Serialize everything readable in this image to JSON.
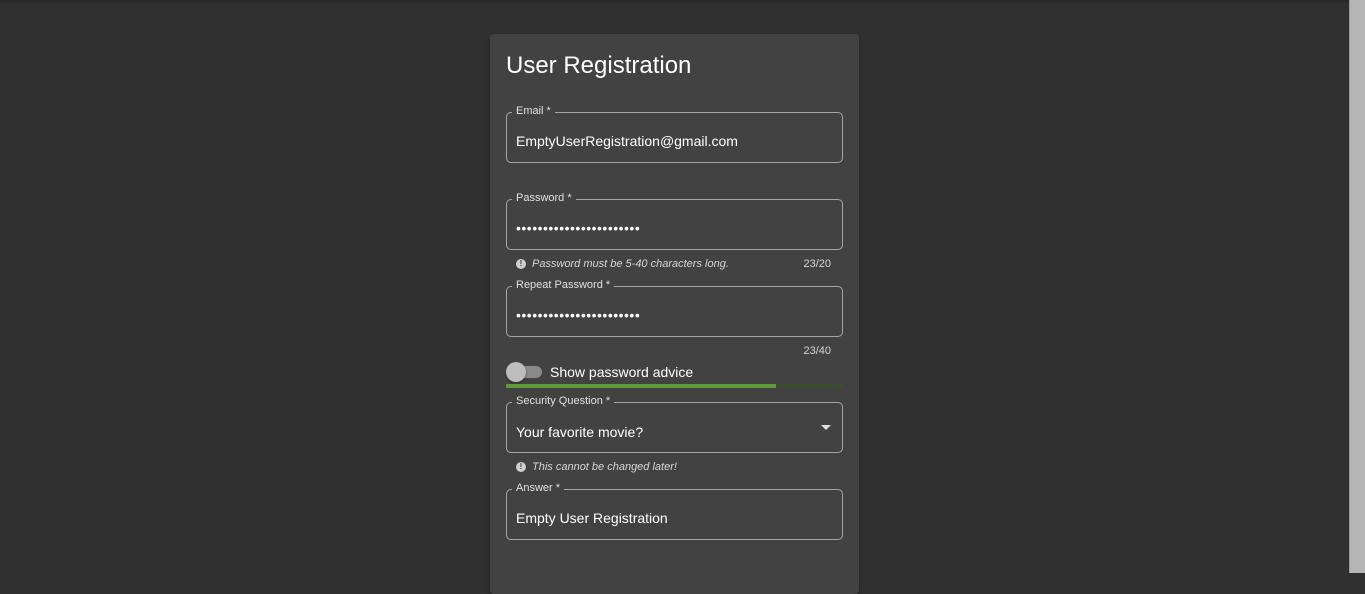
{
  "form": {
    "title": "User Registration",
    "email": {
      "label": "Email *",
      "value": "EmptyUserRegistration@gmail.com"
    },
    "password": {
      "label": "Password *",
      "masked_value": "•••••••••••••••••••••••",
      "hint": "Password must be 5-40 characters long.",
      "counter": "23/20"
    },
    "repeat_password": {
      "label": "Repeat Password *",
      "masked_value": "•••••••••••••••••••••••",
      "counter": "23/40"
    },
    "advice_toggle": {
      "label": "Show password advice",
      "checked": false
    },
    "strength": {
      "fraction": 0.8,
      "color": "#5e9b3b"
    },
    "security_question": {
      "label": "Security Question *",
      "value": "Your favorite movie?",
      "hint": "This cannot be changed later!"
    },
    "answer": {
      "label": "Answer *",
      "value": "Empty User Registration"
    }
  }
}
